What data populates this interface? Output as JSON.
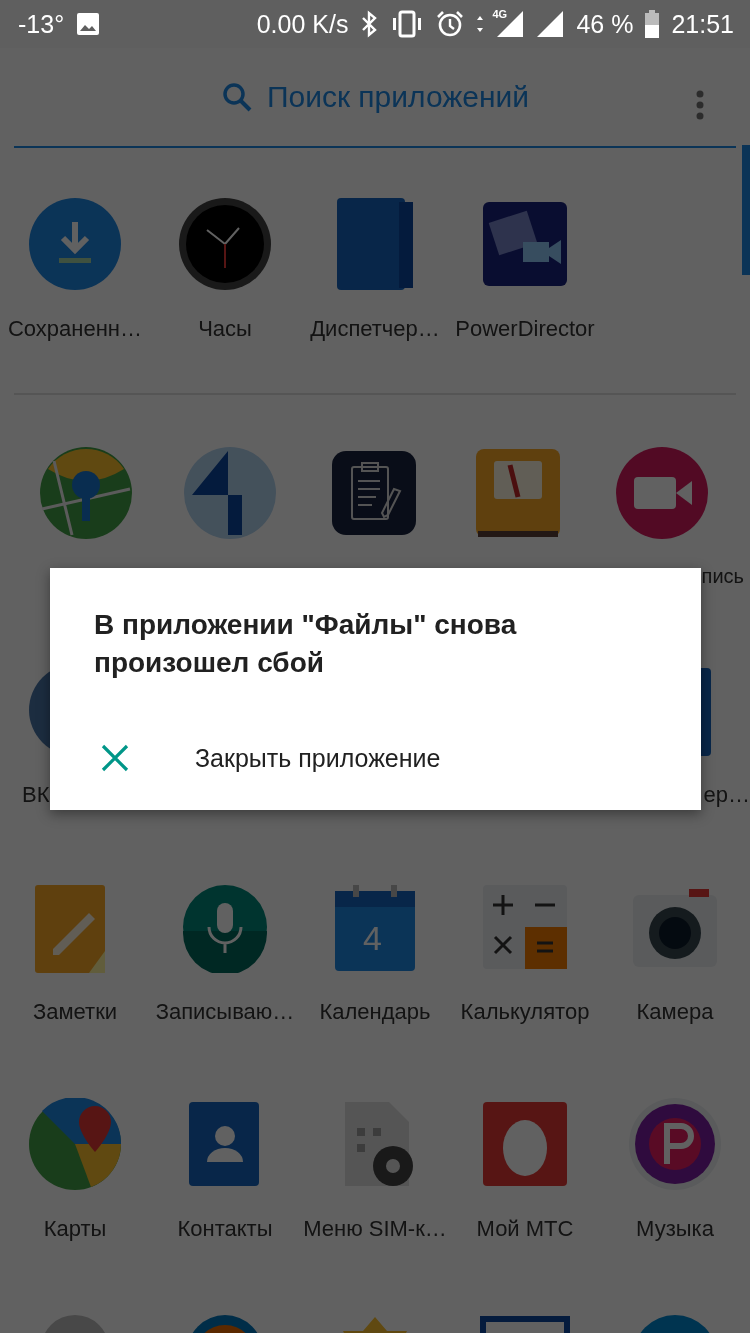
{
  "status_bar": {
    "temperature": "-13°",
    "speed": "0.00 K/s",
    "network": "4G",
    "battery": "46 %",
    "time": "21:51"
  },
  "search": {
    "placeholder": "Поиск приложений"
  },
  "app_rows": [
    {
      "labels": [
        "Сохраненн…",
        "Часы",
        "Диспетчер…",
        "PowerDirector"
      ]
    },
    {
      "labels": [
        "пись"
      ]
    },
    {
      "labels": [
        "ВК",
        "ер…"
      ]
    },
    {
      "labels": [
        "Заметки",
        "Записываю…",
        "Календарь",
        "Калькулятор",
        "Камера"
      ],
      "calendar_day": "4"
    },
    {
      "labels": [
        "Карты",
        "Контакты",
        "Меню SIM-к…",
        "Мой МТС",
        "Музыка"
      ]
    },
    {}
  ],
  "dialog": {
    "title": "В приложении \"Файлы\" снова произошел сбой",
    "actions": [
      {
        "label": "Закрыть приложение"
      }
    ]
  }
}
